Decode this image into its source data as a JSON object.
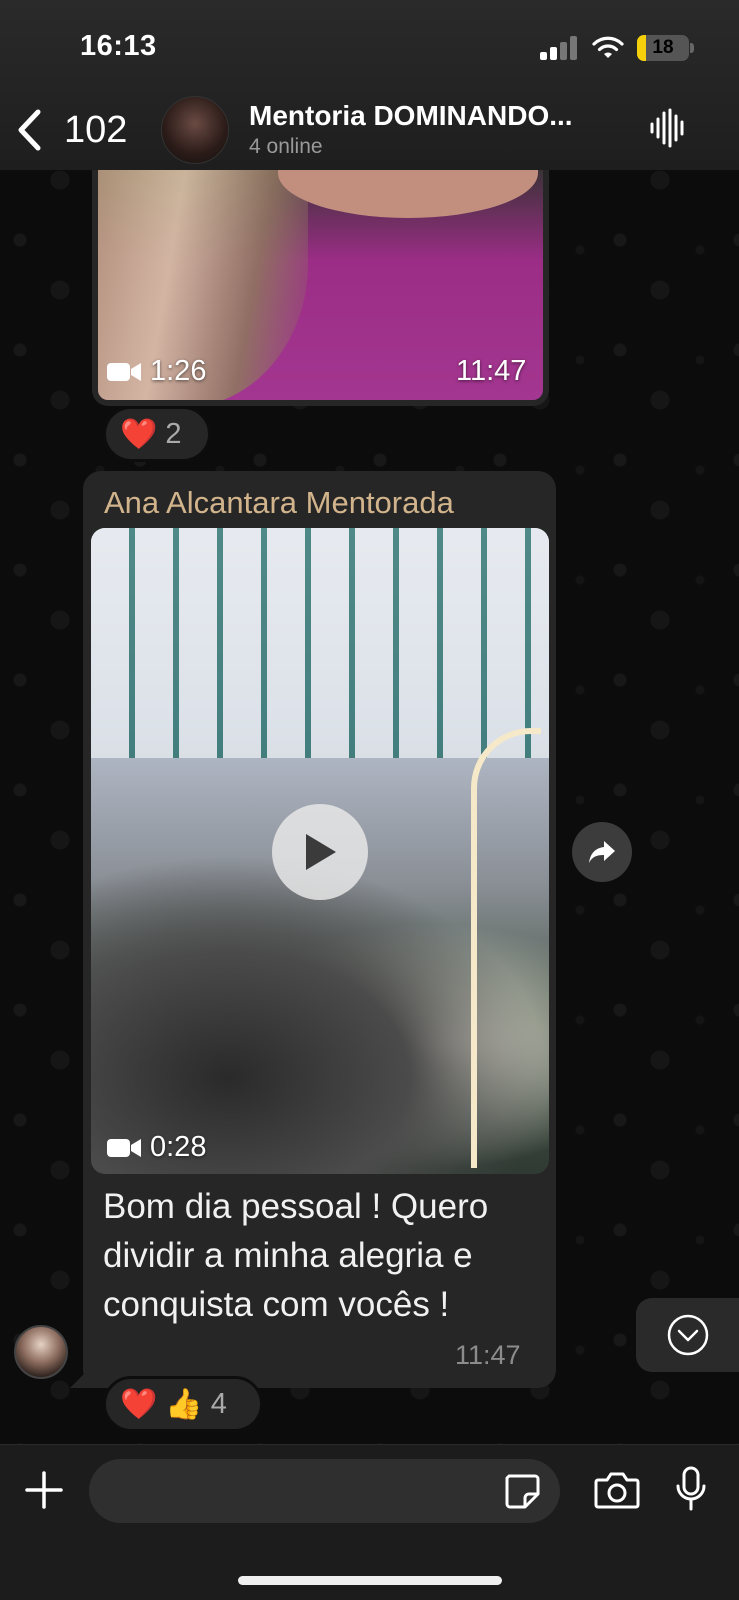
{
  "status_bar": {
    "time": "16:13",
    "battery": "18"
  },
  "header": {
    "back_count": "102",
    "title": "Mentoria DOMINANDO...",
    "subtitle": "4 online"
  },
  "messages": [
    {
      "media": {
        "duration": "1:26",
        "time": "11:47"
      },
      "reactions": {
        "emoji": "❤️",
        "count": "2"
      }
    },
    {
      "sender": "Ana Alcantara Mentorada",
      "media": {
        "duration": "0:28"
      },
      "caption": "Bom dia pessoal ! Quero dividir a minha alegria e conquista com vocês !",
      "time": "11:47",
      "reactions": {
        "emoji1": "❤️",
        "emoji2": "👍",
        "count": "4"
      }
    }
  ],
  "composer": {
    "placeholder": ""
  },
  "colors": {
    "sender_name": "#d2b48c",
    "bubble": "#262626",
    "heart": "#e8343b"
  }
}
